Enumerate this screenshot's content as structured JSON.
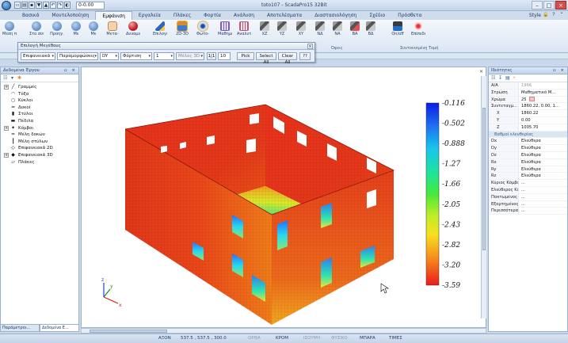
{
  "window": {
    "title": "toto107 - ScadaPro15 32Bit",
    "combo_value": "0-0.00",
    "winbtns": [
      "–",
      "□",
      "×"
    ]
  },
  "tabs": [
    "Βασικά",
    "Μοντελοποίηση",
    "Εμφάνιση",
    "Εργαλεία",
    "Πλάκες",
    "Φορτία",
    "Ανάλυση",
    "Αποτελέσματα",
    "Διαστασιολόγηση",
    "Σχέδιο",
    "Πρόσθετα"
  ],
  "active_tab": 2,
  "style_label": "Style",
  "ribbon": {
    "buttons": [
      {
        "label": "Μέση παραθ.",
        "icon": "blue"
      },
      {
        "label": "Στο σύνολο",
        "icon": "blue"
      },
      {
        "label": "Προηγ.",
        "icon": "blue"
      },
      {
        "label": "Με",
        "icon": "blue"
      },
      {
        "label": "Με",
        "icon": "blue"
      },
      {
        "label": "Μετα-",
        "icon": "hand"
      },
      {
        "label": "Δυναμική",
        "icon": "ball"
      },
      {
        "label": "Επιλογές",
        "icon": "pencil"
      },
      {
        "label": "2D-3D",
        "icon": "house"
      },
      {
        "label": "Φωτο-",
        "icon": "eye"
      },
      {
        "label": "Μαθηματικό",
        "icon": "grid"
      },
      {
        "label": "Αναλυτικό",
        "icon": "frame"
      },
      {
        "label": "XZ",
        "icon": "cube"
      },
      {
        "label": "YZ",
        "icon": "cube"
      },
      {
        "label": "XY",
        "icon": "cube"
      },
      {
        "label": "ΝΔ",
        "icon": "cube"
      },
      {
        "label": "ΝΑ",
        "icon": "cube"
      },
      {
        "label": "ΒΑ",
        "icon": "cube red"
      },
      {
        "label": "ΒΔ",
        "icon": "cube"
      },
      {
        "label": "On/off",
        "icon": "onoff"
      },
      {
        "label": "Επίπεδα",
        "icon": "epi"
      }
    ],
    "group_labels": [
      "Όψεις",
      "Συντονισμένη Τομή"
    ]
  },
  "property_selection": {
    "title": "Επιλογή Μεγέθους",
    "close": "×",
    "dropdowns": [
      "Επιφανειακά",
      "Παραμορφώσεις",
      "DY",
      "Φόρτιση",
      "1",
      "Μέλος 3D"
    ],
    "mid_button": "1|1",
    "number_value": "10",
    "buttons": [
      "Pick",
      "Select All",
      "Clear All",
      "??"
    ]
  },
  "left_panel": {
    "title": "Δεδομένα Έργου",
    "pin": "▫ ×",
    "tree": [
      {
        "label": "Γραμμές",
        "exp": "+",
        "icon": "╱"
      },
      {
        "label": "Τόξα",
        "exp": "",
        "icon": "◠"
      },
      {
        "label": "Κύκλοι",
        "exp": "",
        "icon": "○"
      },
      {
        "label": "Δοκοί",
        "exp": "",
        "icon": "━"
      },
      {
        "label": "Στύλοι",
        "exp": "",
        "icon": "▮"
      },
      {
        "label": "Πέδιλα",
        "exp": "",
        "icon": "▬"
      },
      {
        "label": "Κόμβοι",
        "exp": "+",
        "icon": "✦"
      },
      {
        "label": "Μέλη δοκών",
        "exp": "",
        "icon": "━"
      },
      {
        "label": "Μέλη στύλων",
        "exp": "",
        "icon": "┃"
      },
      {
        "label": "Επιφανειακά 2D",
        "exp": "",
        "icon": "◇"
      },
      {
        "label": "Επιφανειακά 3D",
        "exp": "+",
        "icon": "◆"
      },
      {
        "label": "Πλάκες",
        "exp": "",
        "icon": "▱"
      }
    ],
    "tabs": [
      "Παράμετροι...",
      "Δεδομένα Ε..."
    ]
  },
  "right_panel": {
    "title": "Ιδιότητες",
    "pin": "▫ ×",
    "rows": [
      {
        "k": "Α/Α",
        "v": "1966",
        "cls": "gray"
      },
      {
        "k": "Στρώση",
        "v": "Μαθηματικό Μ..."
      },
      {
        "k": "Χρώμα",
        "v": "25",
        "swatch": true
      },
      {
        "k": "Συντεταγμ...",
        "v": "1860.22, 0.00, 1..."
      },
      {
        "k": "X",
        "v": "1860.22",
        "indent": true
      },
      {
        "k": "Y",
        "v": "0.00",
        "indent": true
      },
      {
        "k": "Z",
        "v": "1005.70",
        "indent": true
      },
      {
        "k": "Βαθμοί ελευθερίας",
        "v": "",
        "cat": true
      },
      {
        "k": "Dx",
        "v": "Ελεύθερα"
      },
      {
        "k": "Dy",
        "v": "Ελεύθερα"
      },
      {
        "k": "Dz",
        "v": "Ελεύθερα"
      },
      {
        "k": "Rx",
        "v": "Ελεύθερα"
      },
      {
        "k": "Ry",
        "v": "Ελεύθερα"
      },
      {
        "k": "Rz",
        "v": "Ελεύθερα"
      },
      {
        "k": "Κύριος Κόμβος",
        "v": "..."
      },
      {
        "k": "Ελεύθερος Κόμ...",
        "v": "..."
      },
      {
        "k": "Πακτωμένος Κ...",
        "v": "..."
      },
      {
        "k": "Εξαρτημένος Κ...",
        "v": "..."
      },
      {
        "k": "Περισσότερα",
        "v": "..."
      }
    ]
  },
  "legend": {
    "values": [
      "-0.116",
      "-0.502",
      "-0.888",
      "-1.27",
      "-1.66",
      "-2.05",
      "-2.43",
      "-2.82",
      "-3.20",
      "-3.59"
    ]
  },
  "axes": {
    "x": "x",
    "y": "y",
    "z": "z"
  },
  "statusbar": {
    "items": [
      {
        "label": "ΑΞΟΝ",
        "off": false
      },
      {
        "label": "537.5 , 537.5 , 300.0",
        "off": false
      },
      {
        "label": "ΟΡΘΑ",
        "off": true
      },
      {
        "label": "ΚΡΟΜ",
        "off": false
      },
      {
        "label": "ΙΣΟΥΨΗ",
        "off": true
      },
      {
        "label": "ΦΥΣΙΚΟ",
        "off": true
      },
      {
        "label": "ΜΠΑΡΑ",
        "off": false
      },
      {
        "label": "ΤΙΜΕΣ",
        "off": false
      }
    ]
  }
}
